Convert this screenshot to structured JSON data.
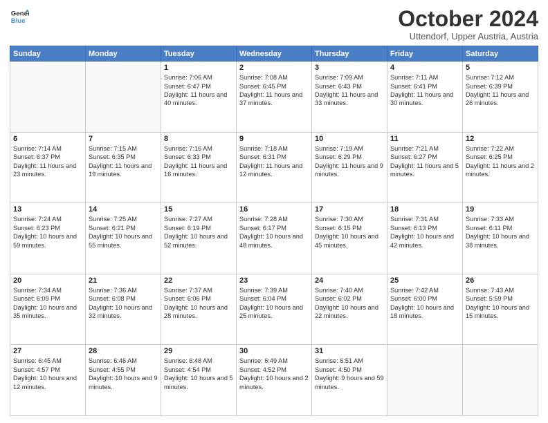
{
  "header": {
    "logo_line1": "General",
    "logo_line2": "Blue",
    "month": "October 2024",
    "location": "Uttendorf, Upper Austria, Austria"
  },
  "days_of_week": [
    "Sunday",
    "Monday",
    "Tuesday",
    "Wednesday",
    "Thursday",
    "Friday",
    "Saturday"
  ],
  "weeks": [
    [
      {
        "num": "",
        "content": ""
      },
      {
        "num": "",
        "content": ""
      },
      {
        "num": "1",
        "content": "Sunrise: 7:06 AM\nSunset: 6:47 PM\nDaylight: 11 hours and 40 minutes."
      },
      {
        "num": "2",
        "content": "Sunrise: 7:08 AM\nSunset: 6:45 PM\nDaylight: 11 hours and 37 minutes."
      },
      {
        "num": "3",
        "content": "Sunrise: 7:09 AM\nSunset: 6:43 PM\nDaylight: 11 hours and 33 minutes."
      },
      {
        "num": "4",
        "content": "Sunrise: 7:11 AM\nSunset: 6:41 PM\nDaylight: 11 hours and 30 minutes."
      },
      {
        "num": "5",
        "content": "Sunrise: 7:12 AM\nSunset: 6:39 PM\nDaylight: 11 hours and 26 minutes."
      }
    ],
    [
      {
        "num": "6",
        "content": "Sunrise: 7:14 AM\nSunset: 6:37 PM\nDaylight: 11 hours and 23 minutes."
      },
      {
        "num": "7",
        "content": "Sunrise: 7:15 AM\nSunset: 6:35 PM\nDaylight: 11 hours and 19 minutes."
      },
      {
        "num": "8",
        "content": "Sunrise: 7:16 AM\nSunset: 6:33 PM\nDaylight: 11 hours and 16 minutes."
      },
      {
        "num": "9",
        "content": "Sunrise: 7:18 AM\nSunset: 6:31 PM\nDaylight: 11 hours and 12 minutes."
      },
      {
        "num": "10",
        "content": "Sunrise: 7:19 AM\nSunset: 6:29 PM\nDaylight: 11 hours and 9 minutes."
      },
      {
        "num": "11",
        "content": "Sunrise: 7:21 AM\nSunset: 6:27 PM\nDaylight: 11 hours and 5 minutes."
      },
      {
        "num": "12",
        "content": "Sunrise: 7:22 AM\nSunset: 6:25 PM\nDaylight: 11 hours and 2 minutes."
      }
    ],
    [
      {
        "num": "13",
        "content": "Sunrise: 7:24 AM\nSunset: 6:23 PM\nDaylight: 10 hours and 59 minutes."
      },
      {
        "num": "14",
        "content": "Sunrise: 7:25 AM\nSunset: 6:21 PM\nDaylight: 10 hours and 55 minutes."
      },
      {
        "num": "15",
        "content": "Sunrise: 7:27 AM\nSunset: 6:19 PM\nDaylight: 10 hours and 52 minutes."
      },
      {
        "num": "16",
        "content": "Sunrise: 7:28 AM\nSunset: 6:17 PM\nDaylight: 10 hours and 48 minutes."
      },
      {
        "num": "17",
        "content": "Sunrise: 7:30 AM\nSunset: 6:15 PM\nDaylight: 10 hours and 45 minutes."
      },
      {
        "num": "18",
        "content": "Sunrise: 7:31 AM\nSunset: 6:13 PM\nDaylight: 10 hours and 42 minutes."
      },
      {
        "num": "19",
        "content": "Sunrise: 7:33 AM\nSunset: 6:11 PM\nDaylight: 10 hours and 38 minutes."
      }
    ],
    [
      {
        "num": "20",
        "content": "Sunrise: 7:34 AM\nSunset: 6:09 PM\nDaylight: 10 hours and 35 minutes."
      },
      {
        "num": "21",
        "content": "Sunrise: 7:36 AM\nSunset: 6:08 PM\nDaylight: 10 hours and 32 minutes."
      },
      {
        "num": "22",
        "content": "Sunrise: 7:37 AM\nSunset: 6:06 PM\nDaylight: 10 hours and 28 minutes."
      },
      {
        "num": "23",
        "content": "Sunrise: 7:39 AM\nSunset: 6:04 PM\nDaylight: 10 hours and 25 minutes."
      },
      {
        "num": "24",
        "content": "Sunrise: 7:40 AM\nSunset: 6:02 PM\nDaylight: 10 hours and 22 minutes."
      },
      {
        "num": "25",
        "content": "Sunrise: 7:42 AM\nSunset: 6:00 PM\nDaylight: 10 hours and 18 minutes."
      },
      {
        "num": "26",
        "content": "Sunrise: 7:43 AM\nSunset: 5:59 PM\nDaylight: 10 hours and 15 minutes."
      }
    ],
    [
      {
        "num": "27",
        "content": "Sunrise: 6:45 AM\nSunset: 4:57 PM\nDaylight: 10 hours and 12 minutes."
      },
      {
        "num": "28",
        "content": "Sunrise: 6:46 AM\nSunset: 4:55 PM\nDaylight: 10 hours and 9 minutes."
      },
      {
        "num": "29",
        "content": "Sunrise: 6:48 AM\nSunset: 4:54 PM\nDaylight: 10 hours and 5 minutes."
      },
      {
        "num": "30",
        "content": "Sunrise: 6:49 AM\nSunset: 4:52 PM\nDaylight: 10 hours and 2 minutes."
      },
      {
        "num": "31",
        "content": "Sunrise: 6:51 AM\nSunset: 4:50 PM\nDaylight: 9 hours and 59 minutes."
      },
      {
        "num": "",
        "content": ""
      },
      {
        "num": "",
        "content": ""
      }
    ]
  ]
}
